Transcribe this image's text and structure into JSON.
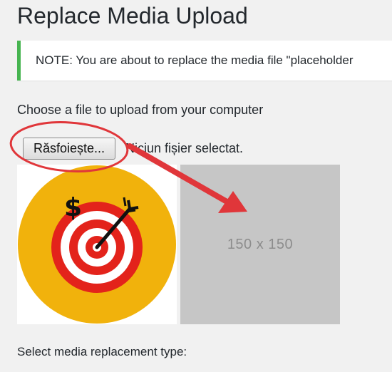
{
  "page": {
    "title": "Replace Media Upload"
  },
  "notice": {
    "text": "NOTE: You are about to replace the media file \"placeholder",
    "accent_color": "#46b450"
  },
  "upload": {
    "choose_label": "Choose a file to upload from your computer",
    "browse_button_label": "Răsfoiește...",
    "file_status": "Niciun fișier selectat."
  },
  "previews": {
    "current_image_icon": "dollar-target-arrow-icon",
    "placeholder_text": "150 x 150"
  },
  "replacement": {
    "type_label": "Select media replacement type:"
  },
  "annotations": {
    "highlight_color": "#e0363a",
    "highlight_icon": "red-circle-highlight",
    "arrow_icon": "red-arrow"
  }
}
